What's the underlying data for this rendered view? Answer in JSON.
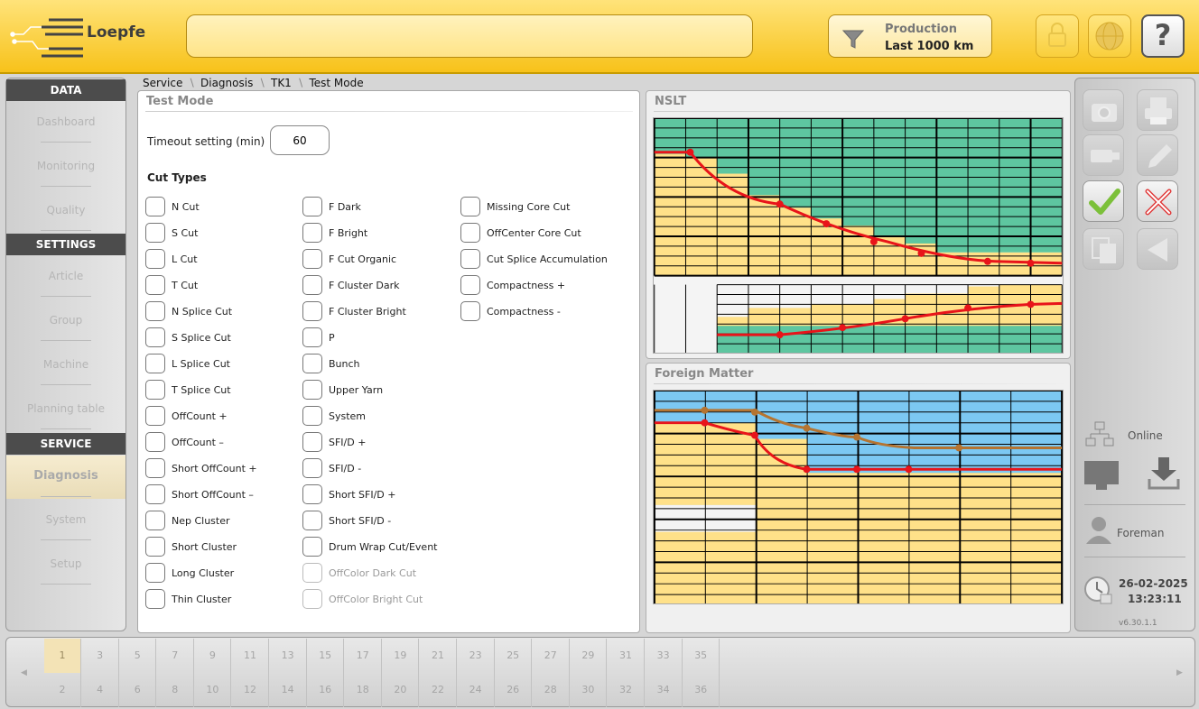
{
  "header": {
    "brand": "Loepfe",
    "production_label": "Production",
    "production_value": "Last 1000 km",
    "help_label": "?"
  },
  "nav": {
    "sections": [
      {
        "heading": "DATA",
        "items": [
          "Dashboard",
          "Monitoring",
          "Quality"
        ]
      },
      {
        "heading": "SETTINGS",
        "items": [
          "Article",
          "Group",
          "Machine",
          "Planning table"
        ]
      },
      {
        "heading": "SERVICE",
        "items": [
          "Diagnosis",
          "System",
          "Setup"
        ]
      }
    ],
    "active": "Diagnosis"
  },
  "breadcrumb": [
    "Service",
    "Diagnosis",
    "TK1",
    "Test Mode"
  ],
  "testmode": {
    "title": "Test Mode",
    "timeout_label": "Timeout setting (min)",
    "timeout_value": "60",
    "cut_types_label": "Cut Types",
    "col1": [
      "N Cut",
      "S Cut",
      "L Cut",
      "T Cut",
      "N Splice Cut",
      "S Splice Cut",
      "L Splice Cut",
      "T Splice Cut",
      "OffCount +",
      "OffCount –",
      "Short OffCount +",
      "Short OffCount –",
      "Nep Cluster",
      "Short Cluster",
      "Long Cluster",
      "Thin Cluster"
    ],
    "col2": [
      "F Dark",
      "F Bright",
      "F Cut Organic",
      "F Cluster Dark",
      "F Cluster Bright",
      "P",
      "Bunch",
      "Upper Yarn",
      "System",
      "SFI/D +",
      "SFI/D -",
      "Short SFI/D +",
      "Short SFI/D -",
      "Drum Wrap Cut/Event",
      "OffColor Dark Cut",
      "OffColor Bright Cut"
    ],
    "col3": [
      "Missing Core Cut",
      "OffCenter Core Cut",
      "Cut Splice Accumulation",
      "Compactness +",
      "Compactness -"
    ],
    "col2_disabled": [
      "OffColor Dark Cut",
      "OffColor Bright Cut"
    ]
  },
  "nslt": {
    "title": "NSLT"
  },
  "foreign_matter": {
    "title": "Foreign Matter"
  },
  "right": {
    "online": "Online",
    "user": "Foreman",
    "date": "26-02-2025",
    "time": "13:23:11",
    "version": "v6.30.1.1"
  },
  "spindles": {
    "top": [
      "1",
      "3",
      "5",
      "7",
      "9",
      "11",
      "13",
      "15",
      "17",
      "19",
      "21",
      "23",
      "25",
      "27",
      "29",
      "31",
      "33",
      "35"
    ],
    "bottom": [
      "2",
      "4",
      "6",
      "8",
      "10",
      "12",
      "14",
      "16",
      "18",
      "20",
      "22",
      "24",
      "26",
      "28",
      "30",
      "32",
      "34",
      "36"
    ],
    "active": "1"
  },
  "colors": {
    "accent": "#f7c21a",
    "grid_green": "#5ec6a0",
    "grid_yellow": "#ffe189",
    "grid_blue": "#7cc8f2",
    "curve_red": "#e8141a",
    "curve_brown": "#b57431"
  }
}
